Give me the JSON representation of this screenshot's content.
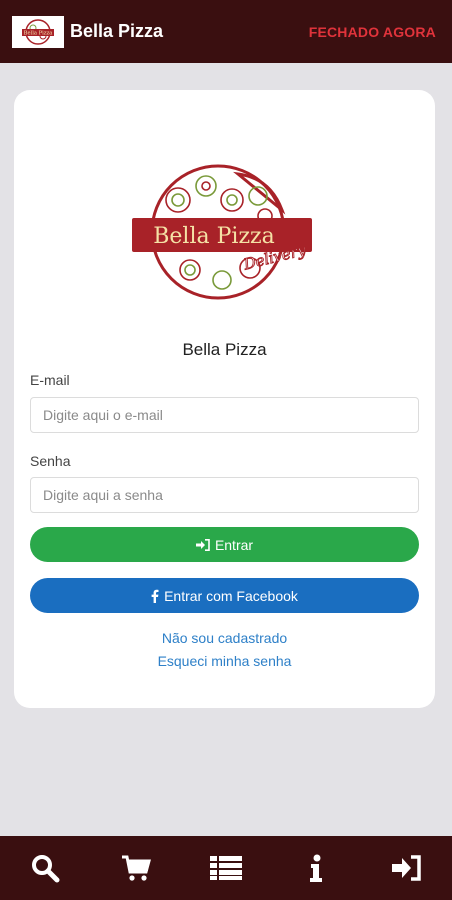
{
  "header": {
    "logo_text": "Bella Pizza",
    "title": "Bella Pizza",
    "status": "FECHADO AGORA"
  },
  "login": {
    "logo_text_main": "Bella Pizza",
    "logo_text_sub": "Delivery",
    "restaurant_name": "Bella Pizza",
    "email_label": "E-mail",
    "email_placeholder": "Digite aqui o e-mail",
    "email_value": "",
    "password_label": "Senha",
    "password_placeholder": "Digite aqui a senha",
    "password_value": "",
    "login_button": "Entrar",
    "facebook_button": "Entrar com Facebook",
    "register_link": "Não sou cadastrado",
    "forgot_link": "Esqueci minha senha"
  },
  "bottom_nav": [
    {
      "icon": "search-icon"
    },
    {
      "icon": "cart-icon"
    },
    {
      "icon": "list-icon"
    },
    {
      "icon": "info-icon"
    },
    {
      "icon": "sign-in-icon"
    }
  ],
  "colors": {
    "bar_bg": "#3a0f10",
    "status_red": "#e0333b",
    "green": "#2aa84a",
    "blue": "#1a6ec0",
    "link": "#2e80c8",
    "logo_red": "#a82228"
  }
}
